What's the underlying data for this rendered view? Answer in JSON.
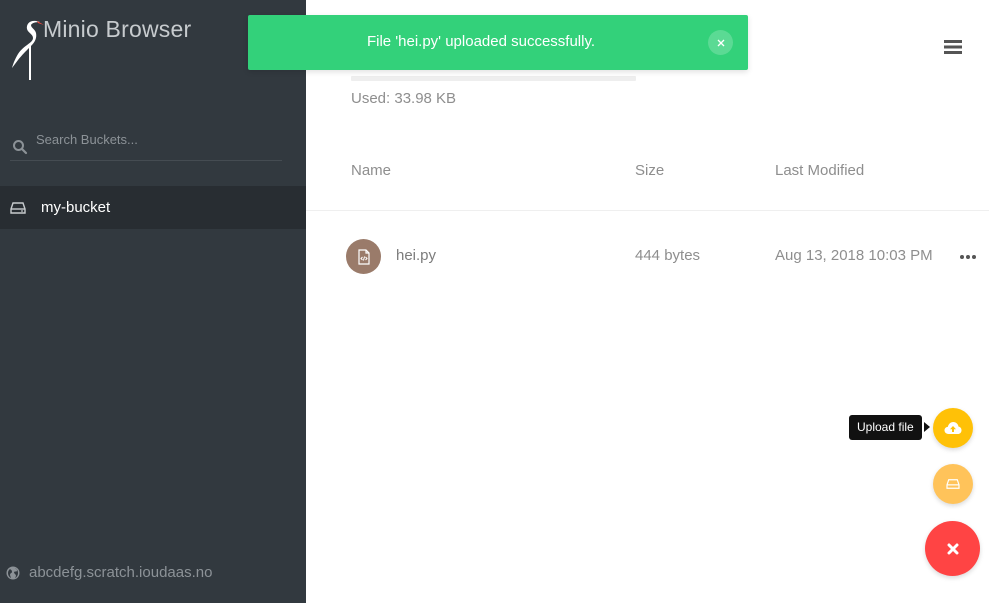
{
  "app": {
    "title": "Minio Browser",
    "logo_icon": "heron-logo-icon"
  },
  "sidebar": {
    "search": {
      "placeholder": "Search Buckets...",
      "value": "",
      "icon": "search-icon"
    },
    "buckets": [
      {
        "label": "my-bucket",
        "icon": "drive-icon",
        "active": true
      }
    ],
    "host": {
      "label": "abcdefg.scratch.ioudaas.no",
      "icon": "globe-icon"
    }
  },
  "storage": {
    "used_label": "Used: 33.98 KB",
    "used_fraction": 0.0
  },
  "header": {
    "menu_icon": "hamburger-menu-icon"
  },
  "table": {
    "columns": {
      "name": "Name",
      "size": "Size",
      "modified": "Last Modified"
    },
    "rows": [
      {
        "name": "hei.py",
        "size": "444 bytes",
        "modified": "Aug 13, 2018 10:03 PM",
        "icon": "code-file-icon",
        "actions_icon": "more-horizontal-icon"
      }
    ]
  },
  "toast": {
    "message": "File 'hei.py' uploaded successfully.",
    "close_icon": "close-icon"
  },
  "fab": {
    "upload_tooltip": "Upload file",
    "upload_icon": "cloud-upload-icon",
    "bucket_icon": "drive-icon",
    "main_icon": "close-icon"
  },
  "colors": {
    "sidebar_bg": "#32393f",
    "sidebar_active": "#282d32",
    "toast_bg": "#33d17a",
    "fab_upload": "#ffc107",
    "fab_bucket": "#ffc35a",
    "fab_main": "#ff4444",
    "file_icon_bg": "#9a7b6a"
  }
}
